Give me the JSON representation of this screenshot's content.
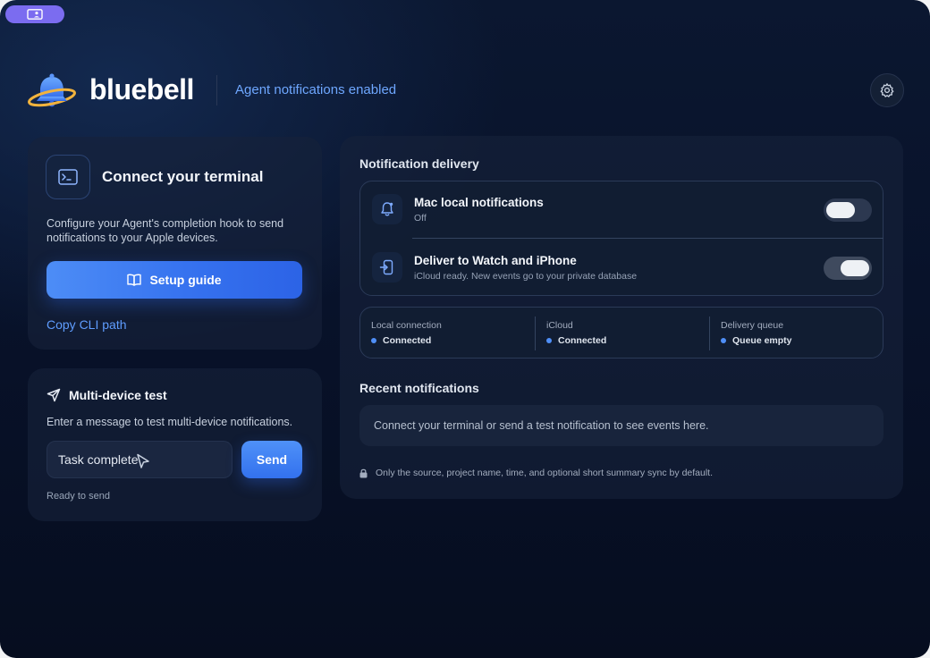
{
  "app": {
    "brand": "bluebell",
    "status": "Agent notifications enabled"
  },
  "colors": {
    "accent": "#3b7bf2",
    "link": "#5f9dff",
    "status_dot": "#4f8ff7",
    "badge": "#7b6cf0"
  },
  "connect_card": {
    "title": "Connect your terminal",
    "description": "Configure your Agent's completion hook to send notifications to your Apple devices.",
    "setup_button": "Setup guide",
    "copy_link": "Copy CLI path"
  },
  "test_card": {
    "title": "Multi-device test",
    "description": "Enter a message to test multi-device notifications.",
    "input_value": "Task complete",
    "send_button": "Send",
    "status": "Ready to send"
  },
  "delivery": {
    "section_title": "Notification delivery",
    "rows": [
      {
        "icon": "bell-icon",
        "title": "Mac local notifications",
        "subtitle": "Off",
        "enabled": false
      },
      {
        "icon": "device-icon",
        "title": "Deliver to Watch and iPhone",
        "subtitle": "iCloud ready. New events go to your private database",
        "enabled": true
      }
    ]
  },
  "connection_status": [
    {
      "label": "Local connection",
      "value": "Connected"
    },
    {
      "label": "iCloud",
      "value": "Connected"
    },
    {
      "label": "Delivery queue",
      "value": "Queue empty"
    }
  ],
  "recent": {
    "section_title": "Recent notifications",
    "empty_text": "Connect your terminal or send a test notification to see events here.",
    "privacy_note": "Only the source, project name, time, and optional short summary sync by default."
  }
}
